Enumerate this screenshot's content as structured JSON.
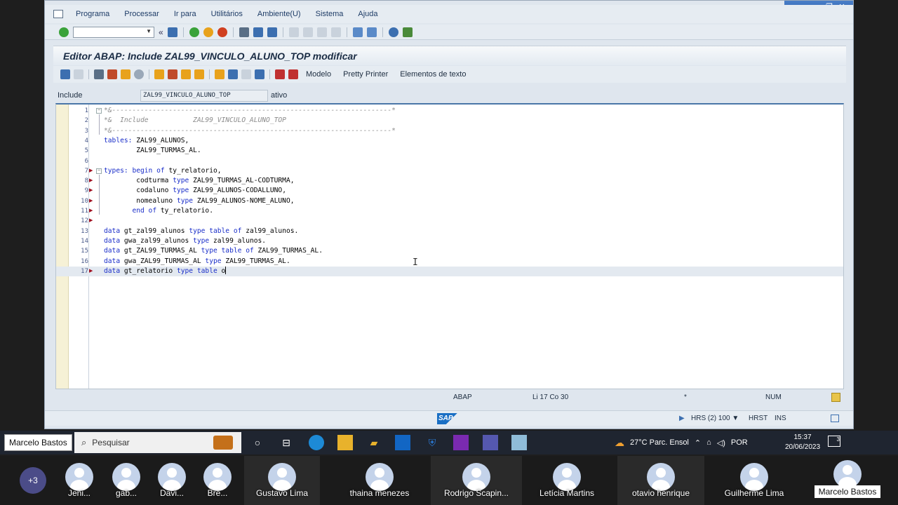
{
  "window": {
    "menu": [
      "Programa",
      "Processar",
      "Ir para",
      "Utilitários",
      "Ambiente(U)",
      "Sistema",
      "Ajuda"
    ],
    "controls": {
      "minimize": "—",
      "restore": "❐",
      "close": "✕"
    }
  },
  "editor": {
    "title": "Editor ABAP: Include ZAL99_VINCULO_ALUNO_TOP modificar",
    "toolbar_texts": {
      "modelo": "Modelo",
      "pretty_printer": "Pretty Printer",
      "elementos": "Elementos de texto"
    },
    "include_label": "Include",
    "include_value": "ZAL99_VINCULO_ALUNO_TOP",
    "include_status": "ativo",
    "lines": [
      {
        "n": "1",
        "text": "*&---------------------------------------------------------------------*",
        "type": "comment",
        "indent": 0
      },
      {
        "n": "2",
        "text": "*&  Include           ZAL99_VINCULO_ALUNO_TOP",
        "type": "comment",
        "indent": 0
      },
      {
        "n": "3",
        "text": "*&---------------------------------------------------------------------*",
        "type": "comment",
        "indent": 0
      },
      {
        "n": "4",
        "text": "tables: ZAL99_ALUNOS,",
        "type": "code",
        "indent": 0
      },
      {
        "n": "5",
        "text": "        ZAL99_TURMAS_AL.",
        "type": "code",
        "indent": 0
      },
      {
        "n": "6",
        "text": "",
        "type": "code",
        "indent": 0
      },
      {
        "n": "7",
        "text": "types: begin of ty_relatorio,",
        "type": "code",
        "indent": 0
      },
      {
        "n": "8",
        "text": "        codturma type ZAL99_TURMAS_AL-CODTURMA,",
        "type": "code",
        "indent": 0
      },
      {
        "n": "9",
        "text": "        codaluno type ZAL99_ALUNOS-CODALLUNO,",
        "type": "code",
        "indent": 0
      },
      {
        "n": "10",
        "text": "        nomealuno type ZAL99_ALUNOS-NOME_ALUNO,",
        "type": "code",
        "indent": 0
      },
      {
        "n": "11",
        "text": "       end of ty_relatorio.",
        "type": "code",
        "indent": 0
      },
      {
        "n": "12",
        "text": "",
        "type": "code",
        "indent": 0
      },
      {
        "n": "13",
        "text": "data gt_zal99_alunos type table of zal99_alunos.",
        "type": "code",
        "indent": 0
      },
      {
        "n": "14",
        "text": "data gwa_zal99_alunos type zal99_alunos.",
        "type": "code",
        "indent": 0
      },
      {
        "n": "15",
        "text": "data gt_ZAL99_TURMAS_AL type table of ZAL99_TURMAS_AL.",
        "type": "code",
        "indent": 0
      },
      {
        "n": "16",
        "text": "data gwa_ZAL99_TURMAS_AL type ZAL99_TURMAS_AL.",
        "type": "code",
        "indent": 0
      },
      {
        "n": "17",
        "text": "data gt_relatorio type table o",
        "type": "code",
        "indent": 0
      }
    ],
    "status": {
      "lang": "ABAP",
      "position": "Li 17 Co 30",
      "modified": "*",
      "num": "NUM"
    }
  },
  "statusbar": {
    "sap": "SAP",
    "system": "HRS (2) 100",
    "host": "HRST",
    "mode": "INS"
  },
  "taskbar": {
    "tooltip": "Marcelo Bastos",
    "search_placeholder": "Pesquisar",
    "weather": "27°C  Parc. Ensol",
    "lang": "POR",
    "time": "15:37",
    "date": "20/06/2023",
    "notifications": "3"
  },
  "meeting": {
    "more": "+3",
    "participants": [
      "Jeni...",
      "gab...",
      "Davi...",
      "Bre...",
      "Gustavo Lima",
      "thaina menezes",
      "Rodrigo Scapin...",
      "Letícia Martins",
      "otavio henrique",
      "Guilherme Lima",
      "Marcelo Bastos"
    ]
  },
  "colors": {
    "keyword": "#1a2ec9",
    "comment": "#8c8c8c",
    "accent": "#4a76a8"
  }
}
